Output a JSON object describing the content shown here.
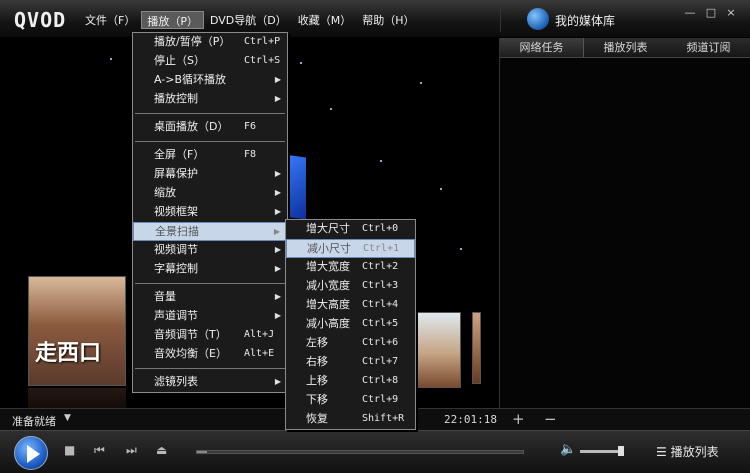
{
  "app": {
    "logo": "QVOD",
    "media_library": "我的媒体库"
  },
  "menubar": [
    "文件（F）",
    "播放（P）",
    "DVD导航（D）",
    "收藏（M）",
    "帮助（H）"
  ],
  "window_controls": {
    "minimize": "—",
    "restore": "□",
    "close": "×"
  },
  "play_menu": [
    {
      "label": "播放/暂停（P）",
      "shortcut": "Ctrl+P"
    },
    {
      "label": "停止（S）",
      "shortcut": "Ctrl+S"
    },
    {
      "label": "A->B循环播放",
      "submenu": true
    },
    {
      "label": "播放控制",
      "submenu": true
    },
    {
      "sep": true
    },
    {
      "label": "桌面播放（D）",
      "shortcut": "F6"
    },
    {
      "sep": true
    },
    {
      "label": "全屏（F）",
      "shortcut": "F8"
    },
    {
      "label": "屏幕保护",
      "submenu": true
    },
    {
      "label": "缩放",
      "submenu": true
    },
    {
      "label": "视频框架",
      "submenu": true
    },
    {
      "label": "全景扫描",
      "submenu": true,
      "highlighted": true
    },
    {
      "label": "视频调节",
      "submenu": true
    },
    {
      "label": "字幕控制",
      "submenu": true
    },
    {
      "sep": true
    },
    {
      "label": "音量",
      "submenu": true
    },
    {
      "label": "声道调节",
      "submenu": true
    },
    {
      "label": "音频调节（T）",
      "shortcut": "Alt+J"
    },
    {
      "label": "音效均衡（E）",
      "shortcut": "Alt+E"
    },
    {
      "sep": true
    },
    {
      "label": "滤镜列表",
      "submenu": true
    }
  ],
  "pan_scan_menu": [
    {
      "label": "增大尺寸",
      "shortcut": "Ctrl+0"
    },
    {
      "label": "减小尺寸",
      "shortcut": "Ctrl+1",
      "highlighted": true
    },
    {
      "label": "增大宽度",
      "shortcut": "Ctrl+2"
    },
    {
      "label": "减小宽度",
      "shortcut": "Ctrl+3"
    },
    {
      "label": "增大高度",
      "shortcut": "Ctrl+4"
    },
    {
      "label": "减小高度",
      "shortcut": "Ctrl+5"
    },
    {
      "label": "左移",
      "shortcut": "Ctrl+6"
    },
    {
      "label": "右移",
      "shortcut": "Ctrl+7"
    },
    {
      "label": "上移",
      "shortcut": "Ctrl+8"
    },
    {
      "label": "下移",
      "shortcut": "Ctrl+9"
    },
    {
      "label": "恢复",
      "shortcut": "Shift+R"
    }
  ],
  "panel": {
    "tabs": [
      "网络任务",
      "播放列表",
      "频道订阅"
    ],
    "add": "+",
    "remove": "−"
  },
  "status": {
    "text": "准备就绪",
    "timecode": "22:01:18",
    "arrow": "▼"
  },
  "controls": {
    "playlist_label": "播放列表",
    "progress_fraction": 0.03,
    "volume_fraction": 0.85
  },
  "icons": {
    "stop": "■",
    "prev": "⏮",
    "next": "⏭",
    "eject": "⏏",
    "volume": "🔈",
    "playlist": "☰"
  },
  "poster_left_caption": "走西口"
}
